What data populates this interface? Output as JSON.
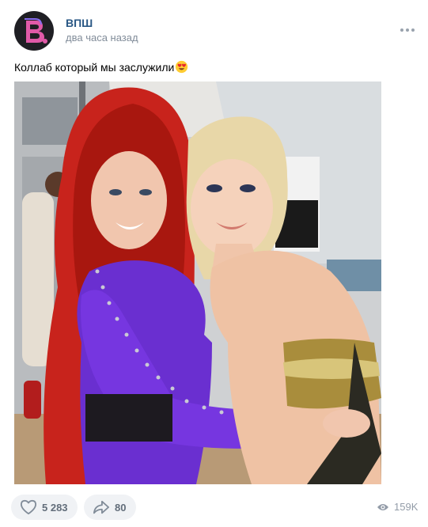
{
  "post": {
    "author": "ВПШ",
    "timestamp": "два часа назад",
    "text": "Коллаб который мы заслужили",
    "emoji_icon": "heart-eyes-emoji",
    "more_icon": "more-horizontal-icon",
    "photo_icon": "post-photo"
  },
  "actions": {
    "likes": "5 283",
    "like_icon": "heart-icon",
    "shares": "80",
    "share_icon": "share-arrow-icon",
    "views": "159K",
    "views_icon": "eye-icon"
  },
  "colors": {
    "author": "#2a5885",
    "secondary_text": "#818c99",
    "button_bg": "#f0f2f5",
    "avatar_bg": "#1f1f24",
    "avatar_logo": "#e05aa8"
  }
}
